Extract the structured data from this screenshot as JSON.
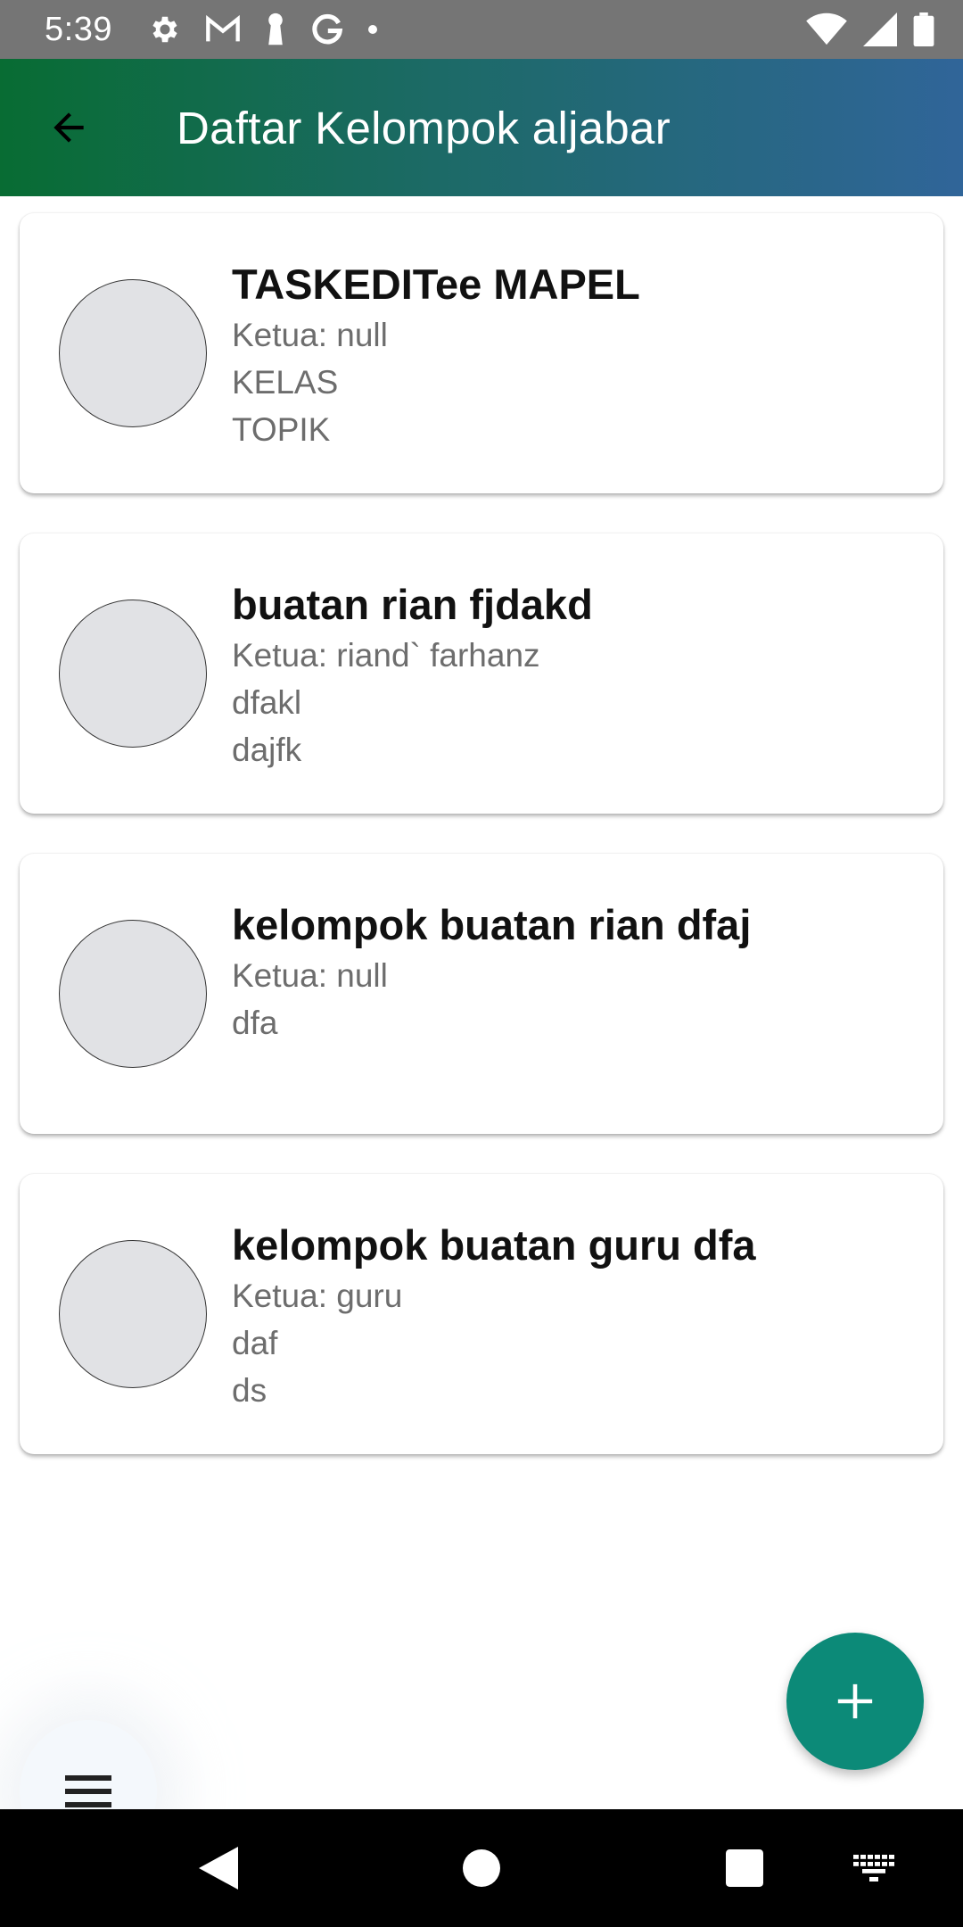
{
  "status_bar": {
    "time": "5:39",
    "left_icons": [
      "settings-icon",
      "gmail-icon",
      "keyhole-icon",
      "google-icon",
      "dot-icon"
    ],
    "right_icons": [
      "wifi-icon",
      "signal-icon",
      "battery-icon"
    ]
  },
  "app_bar": {
    "title": "Daftar Kelompok aljabar",
    "back_icon": "arrow-back-icon",
    "gradient": [
      "#086c33",
      "#306599"
    ]
  },
  "groups": [
    {
      "name": "TASKEDITee MAPEL",
      "leader": "Ketua: null",
      "line1": "KELAS",
      "line2": "TOPIK"
    },
    {
      "name": "buatan rian fjdakd",
      "leader": "Ketua: riand` farhanz",
      "line1": "dfakl",
      "line2": "dajfk"
    },
    {
      "name": "kelompok buatan rian dfaj",
      "leader": "Ketua: null",
      "line1": "dfa",
      "line2": ""
    },
    {
      "name": "kelompok buatan guru dfa",
      "leader": "Ketua: guru",
      "line1": "daf",
      "line2": "ds"
    }
  ],
  "fab": {
    "icon": "plus-icon",
    "color": "#0c8a78"
  },
  "menu_button": {
    "icon": "menu-icon"
  },
  "nav_bar": {
    "buttons": [
      "back-triangle-icon",
      "home-circle-icon",
      "recents-square-icon",
      "keyboard-icon"
    ]
  }
}
